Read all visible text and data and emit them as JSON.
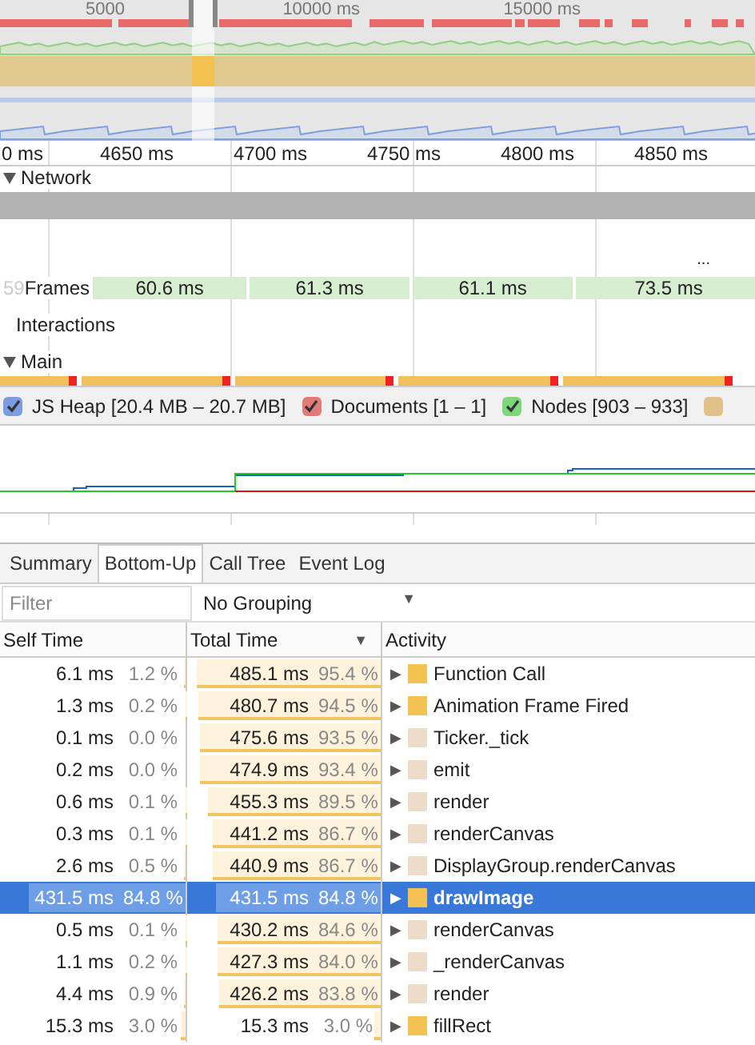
{
  "overview": {
    "ruler": [
      "5000",
      "10000 ms",
      "15000 ms"
    ]
  },
  "timeline": {
    "ruler": [
      "0 ms",
      "4650 ms",
      "4700 ms",
      "4750 ms",
      "4800 ms",
      "4850 ms"
    ],
    "tracks": [
      {
        "label": "Network",
        "expanded": true
      },
      {
        "label": "Frames"
      },
      {
        "label": "Interactions"
      },
      {
        "label": "Main",
        "expanded": true
      }
    ],
    "frames_hidden": "59",
    "frames": [
      "60.6 ms",
      "61.3 ms",
      "61.1 ms",
      "73.5 ms"
    ],
    "more": "...",
    "counters": [
      {
        "label": "JS Heap [20.4 MB – 20.7 MB]",
        "checked": true,
        "color": "#7b9ce0"
      },
      {
        "label": "Documents [1 – 1]",
        "checked": true,
        "color": "#e07b78"
      },
      {
        "label": "Nodes [903 – 933]",
        "checked": true,
        "color": "#7ed67b"
      },
      {
        "checked": false,
        "color": "#e2c08a"
      }
    ]
  },
  "tabs": [
    {
      "label": "Summary",
      "selected": false
    },
    {
      "label": "Bottom-Up",
      "selected": true
    },
    {
      "label": "Call Tree",
      "selected": false
    },
    {
      "label": "Event Log",
      "selected": false
    }
  ],
  "filter": {
    "placeholder": "Filter"
  },
  "grouping": {
    "value": "No Grouping",
    "arrow": "▼"
  },
  "columns": [
    {
      "label": "Self Time",
      "sorted": false
    },
    {
      "label": "Total Time",
      "sorted": true
    },
    {
      "label": "Activity",
      "sorted": false
    }
  ],
  "sort_arrow": "▼",
  "rows": [
    {
      "self": {
        "time": "6.1 ms",
        "percent": "1.2 %",
        "level": 0.012
      },
      "total": {
        "time": "485.1 ms",
        "percent": "95.4 %",
        "level": 0.954
      },
      "activity": "Function Call",
      "color": "#f2c152",
      "selected": false
    },
    {
      "self": {
        "time": "1.3 ms",
        "percent": "0.2 %",
        "level": 0.002
      },
      "total": {
        "time": "480.7 ms",
        "percent": "94.5 %",
        "level": 0.945
      },
      "activity": "Animation Frame Fired",
      "color": "#f2c152",
      "selected": false
    },
    {
      "self": {
        "time": "0.1 ms",
        "percent": "0.0 %",
        "level": 0
      },
      "total": {
        "time": "475.6 ms",
        "percent": "93.5 %",
        "level": 0.935
      },
      "activity": "Ticker._tick",
      "color": "#eedcc8",
      "selected": false
    },
    {
      "self": {
        "time": "0.2 ms",
        "percent": "0.0 %",
        "level": 0
      },
      "total": {
        "time": "474.9 ms",
        "percent": "93.4 %",
        "level": 0.934
      },
      "activity": "emit",
      "color": "#eedcc8",
      "selected": false
    },
    {
      "self": {
        "time": "0.6 ms",
        "percent": "0.1 %",
        "level": 0.001
      },
      "total": {
        "time": "455.3 ms",
        "percent": "89.5 %",
        "level": 0.895
      },
      "activity": "render",
      "color": "#eedcc8",
      "selected": false
    },
    {
      "self": {
        "time": "0.3 ms",
        "percent": "0.1 %",
        "level": 0.001
      },
      "total": {
        "time": "441.2 ms",
        "percent": "86.7 %",
        "level": 0.867
      },
      "activity": "renderCanvas",
      "color": "#eedcc8",
      "selected": false
    },
    {
      "self": {
        "time": "2.6 ms",
        "percent": "0.5 %",
        "level": 0.005
      },
      "total": {
        "time": "440.9 ms",
        "percent": "86.7 %",
        "level": 0.867
      },
      "activity": "DisplayGroup.renderCanvas",
      "color": "#eedcc8",
      "selected": false
    },
    {
      "self": {
        "time": "431.5 ms",
        "percent": "84.8 %",
        "level": 0.848
      },
      "total": {
        "time": "431.5 ms",
        "percent": "84.8 %",
        "level": 0.848
      },
      "activity": "drawImage",
      "color": "#f2c152",
      "selected": true
    },
    {
      "self": {
        "time": "0.5 ms",
        "percent": "0.1 %",
        "level": 0.001
      },
      "total": {
        "time": "430.2 ms",
        "percent": "84.6 %",
        "level": 0.846
      },
      "activity": "renderCanvas",
      "color": "#eedcc8",
      "selected": false
    },
    {
      "self": {
        "time": "1.1 ms",
        "percent": "0.2 %",
        "level": 0.002
      },
      "total": {
        "time": "427.3 ms",
        "percent": "84.0 %",
        "level": 0.84
      },
      "activity": "_renderCanvas",
      "color": "#eedcc8",
      "selected": false
    },
    {
      "self": {
        "time": "4.4 ms",
        "percent": "0.9 %",
        "level": 0.009
      },
      "total": {
        "time": "426.2 ms",
        "percent": "83.8 %",
        "level": 0.838
      },
      "activity": "render",
      "color": "#eedcc8",
      "selected": false
    },
    {
      "self": {
        "time": "15.3 ms",
        "percent": "3.0 %",
        "level": 0.03
      },
      "total": {
        "time": "15.3 ms",
        "percent": "3.0 %",
        "level": 0.03
      },
      "activity": "fillRect",
      "color": "#f2c152",
      "selected": false
    }
  ],
  "expand_arrow": "▶"
}
